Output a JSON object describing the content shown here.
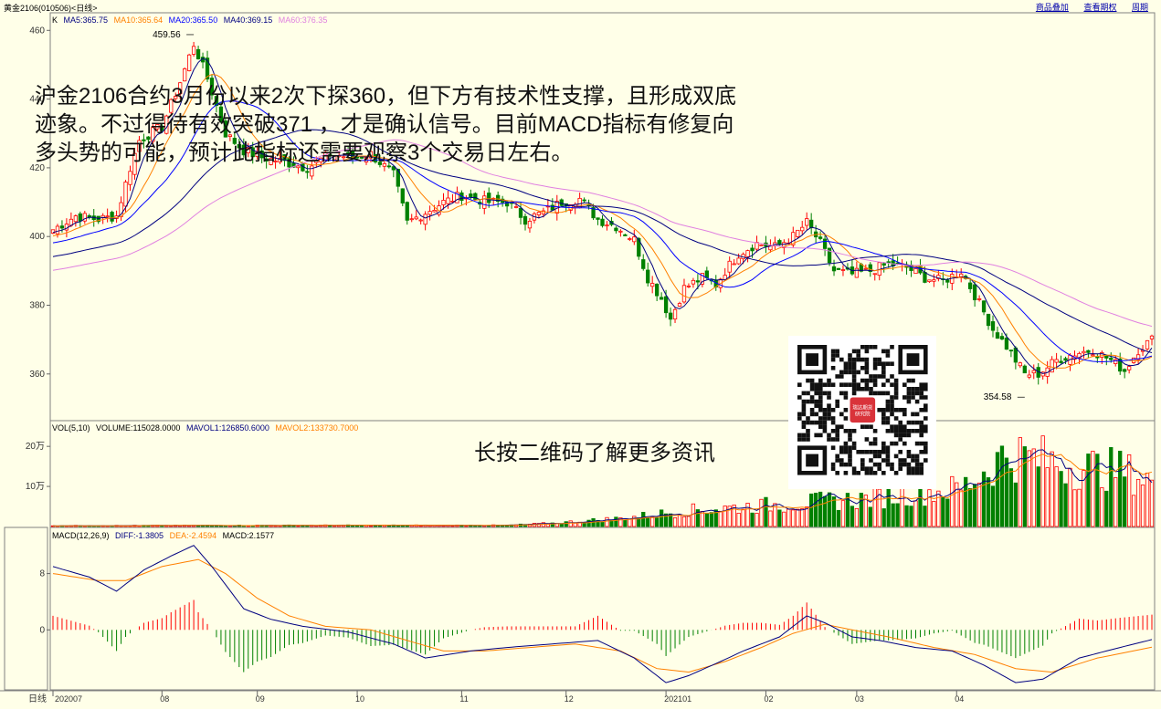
{
  "header": {
    "title": "黄金2106(010506)<日线>",
    "links": [
      "商品叠加",
      "查看期权",
      "周期"
    ]
  },
  "price_panel": {
    "legend": [
      {
        "label": "K",
        "color": "#000000"
      },
      {
        "label": "MA5:365.75",
        "color": "#000080"
      },
      {
        "label": "MA10:365.64",
        "color": "#ff8000"
      },
      {
        "label": "MA20:365.50",
        "color": "#0000ff"
      },
      {
        "label": "MA40:369.15",
        "color": "#000080"
      },
      {
        "label": "MA60:376.35",
        "color": "#e080e0"
      }
    ],
    "high_label": "459.56",
    "low_label": "354.58"
  },
  "volume_panel": {
    "legend": [
      {
        "label": "VOL(5,10)",
        "color": "#000000"
      },
      {
        "label": "VOLUME:115028.0000",
        "color": "#000000"
      },
      {
        "label": "MAVOL1:126850.6000",
        "color": "#000080"
      },
      {
        "label": "MAVOL2:133730.7000",
        "color": "#ff8000"
      }
    ]
  },
  "macd_panel": {
    "legend": [
      {
        "label": "MACD(12,26,9)",
        "color": "#000000"
      },
      {
        "label": "DIFF:-1.3805",
        "color": "#000080"
      },
      {
        "label": "DEA:-2.4594",
        "color": "#ff8000"
      },
      {
        "label": "MACD:2.1577",
        "color": "#000000"
      }
    ]
  },
  "annotation": "沪金2106合约3月份以来2次下探360，但下方有技术性支撑，且形成双底迹象。不过得待有效突破371 ，才是确认信号。目前MACD指标有修复向多头势的可能，预计此指标还需要观察3个交易日左右。",
  "qr_caption": "长按二维码了解更多资讯",
  "qr_logo_text": "瑞达期货研究院",
  "chart_data": [
    {
      "type": "candlestick",
      "title": "",
      "yticks": [
        360,
        380,
        400,
        420,
        440,
        460
      ],
      "ylim": [
        348,
        463
      ],
      "grid": false,
      "xtick_labels": [
        "202007",
        "08",
        "09",
        "10",
        "11",
        "12",
        "202101",
        "02",
        "03",
        "04"
      ],
      "close_keypoints": [
        [
          0,
          402
        ],
        [
          5,
          406
        ],
        [
          10,
          405
        ],
        [
          14,
          406
        ],
        [
          17,
          420
        ],
        [
          19,
          428
        ],
        [
          24,
          432
        ],
        [
          28,
          445
        ],
        [
          31,
          456
        ],
        [
          34,
          446
        ],
        [
          38,
          430
        ],
        [
          42,
          425
        ],
        [
          46,
          423
        ],
        [
          50,
          422
        ],
        [
          56,
          420
        ],
        [
          61,
          424
        ],
        [
          66,
          423
        ],
        [
          70,
          424
        ],
        [
          75,
          418
        ],
        [
          78,
          404
        ],
        [
          82,
          407
        ],
        [
          86,
          410
        ],
        [
          90,
          412
        ],
        [
          96,
          410
        ],
        [
          100,
          410
        ],
        [
          104,
          405
        ],
        [
          108,
          407
        ],
        [
          112,
          410
        ],
        [
          116,
          411
        ],
        [
          120,
          405
        ],
        [
          124,
          403
        ],
        [
          128,
          399
        ],
        [
          131,
          388
        ],
        [
          134,
          382
        ],
        [
          136,
          376
        ],
        [
          139,
          385
        ],
        [
          143,
          388
        ],
        [
          146,
          386
        ],
        [
          148,
          390
        ],
        [
          151,
          395
        ],
        [
          155,
          398
        ],
        [
          159,
          397
        ],
        [
          163,
          400
        ],
        [
          166,
          404
        ],
        [
          169,
          398
        ],
        [
          172,
          390
        ],
        [
          176,
          389
        ],
        [
          180,
          390
        ],
        [
          184,
          392
        ],
        [
          188,
          391
        ],
        [
          192,
          388
        ],
        [
          196,
          387
        ],
        [
          200,
          390
        ],
        [
          203,
          383
        ],
        [
          207,
          373
        ],
        [
          210,
          368
        ],
        [
          214,
          360
        ],
        [
          217,
          360
        ],
        [
          221,
          364
        ],
        [
          225,
          366
        ],
        [
          229,
          367
        ],
        [
          233,
          364
        ],
        [
          236,
          361
        ],
        [
          239,
          367
        ],
        [
          242,
          370
        ]
      ],
      "annotations": [
        {
          "text": "459.56",
          "x": 31,
          "y": 459.56
        },
        {
          "text": "354.58",
          "x": 214,
          "y": 354.58
        }
      ],
      "series": [
        {
          "name": "MA5",
          "value": 365.75
        },
        {
          "name": "MA10",
          "value": 365.64
        },
        {
          "name": "MA20",
          "value": 365.5
        },
        {
          "name": "MA40",
          "value": 369.15
        },
        {
          "name": "MA60",
          "value": 376.35
        }
      ]
    },
    {
      "type": "bar",
      "title": "",
      "yticks": [
        "10万",
        "20万"
      ],
      "ylim": [
        0,
        230000
      ],
      "volume_keypoints": [
        [
          0,
          2000
        ],
        [
          60,
          3000
        ],
        [
          100,
          3000
        ],
        [
          110,
          8000
        ],
        [
          125,
          20000
        ],
        [
          140,
          40000
        ],
        [
          160,
          55000
        ],
        [
          180,
          70000
        ],
        [
          200,
          95000
        ],
        [
          210,
          180000
        ],
        [
          216,
          170000
        ],
        [
          225,
          150000
        ],
        [
          235,
          140000
        ],
        [
          242,
          115028
        ]
      ],
      "series": [
        {
          "name": "VOLUME",
          "value": 115028.0
        },
        {
          "name": "MAVOL1",
          "value": 126850.6
        },
        {
          "name": "MAVOL2",
          "value": 133730.7
        }
      ]
    },
    {
      "type": "line",
      "title": "",
      "yticks": [
        0,
        8
      ],
      "ylim": [
        -8,
        13
      ],
      "diff_keypoints": [
        [
          0,
          9
        ],
        [
          8,
          7.5
        ],
        [
          14,
          5.5
        ],
        [
          20,
          8.5
        ],
        [
          26,
          10.5
        ],
        [
          31,
          12
        ],
        [
          35,
          9
        ],
        [
          42,
          3
        ],
        [
          48,
          1.5
        ],
        [
          55,
          0.5
        ],
        [
          65,
          -0.3
        ],
        [
          75,
          -2
        ],
        [
          82,
          -4
        ],
        [
          92,
          -3
        ],
        [
          100,
          -2.5
        ],
        [
          110,
          -2
        ],
        [
          120,
          -1.5
        ],
        [
          128,
          -4
        ],
        [
          135,
          -7.5
        ],
        [
          140,
          -6.5
        ],
        [
          147,
          -4.5
        ],
        [
          152,
          -3
        ],
        [
          160,
          -1
        ],
        [
          166,
          2
        ],
        [
          170,
          1
        ],
        [
          176,
          -1
        ],
        [
          182,
          -1.5
        ],
        [
          190,
          -2.5
        ],
        [
          198,
          -3
        ],
        [
          205,
          -5
        ],
        [
          212,
          -7.5
        ],
        [
          218,
          -7
        ],
        [
          226,
          -4
        ],
        [
          235,
          -2.5
        ],
        [
          242,
          -1.3805
        ]
      ],
      "dea_keypoints": [
        [
          0,
          8
        ],
        [
          10,
          7
        ],
        [
          16,
          7
        ],
        [
          24,
          9
        ],
        [
          32,
          10
        ],
        [
          38,
          8
        ],
        [
          45,
          4.5
        ],
        [
          52,
          2
        ],
        [
          60,
          0.5
        ],
        [
          70,
          0
        ],
        [
          78,
          -1.5
        ],
        [
          86,
          -3
        ],
        [
          95,
          -3
        ],
        [
          105,
          -2.5
        ],
        [
          115,
          -2
        ],
        [
          125,
          -3
        ],
        [
          133,
          -5.5
        ],
        [
          140,
          -6
        ],
        [
          148,
          -4.5
        ],
        [
          156,
          -2.5
        ],
        [
          163,
          -0.5
        ],
        [
          170,
          0.8
        ],
        [
          176,
          0
        ],
        [
          184,
          -1
        ],
        [
          194,
          -2.5
        ],
        [
          203,
          -3.5
        ],
        [
          212,
          -5.5
        ],
        [
          220,
          -6
        ],
        [
          230,
          -4
        ],
        [
          242,
          -2.4594
        ]
      ],
      "series": [
        {
          "name": "DIFF",
          "value": -1.3805
        },
        {
          "name": "DEA",
          "value": -2.4594
        },
        {
          "name": "MACD",
          "value": 2.1577
        }
      ]
    }
  ]
}
